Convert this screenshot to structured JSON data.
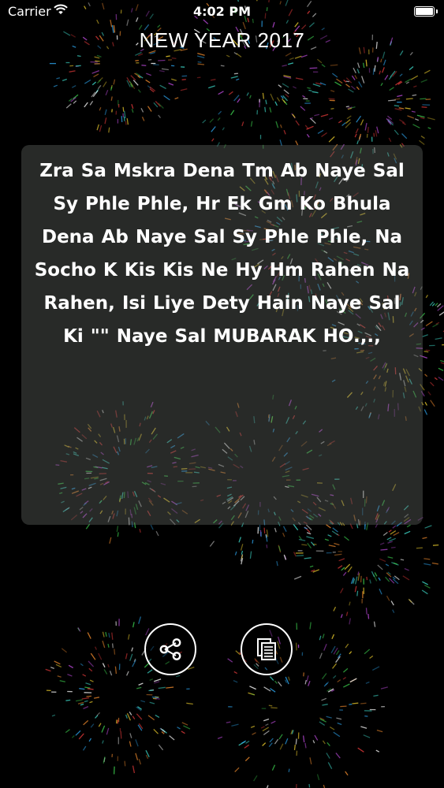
{
  "status_bar": {
    "carrier": "Carrier",
    "time": "4:02 PM",
    "wifi_icon": "wifi-icon",
    "battery_icon": "battery-icon"
  },
  "header": {
    "title": "NEW YEAR 2017"
  },
  "message": {
    "text": "Zra Sa Mskra Dena Tm Ab Naye Sal\nSy Phle Phle,  Hr Ek Gm Ko Bhula\nDena  Ab Naye Sal Sy Phle Phle,  Na\nSocho K Kis Kis Ne  Hy Hm Rahen Na\nRahen,  Isi Liye Dety Hain Naye Sal\nKi      \"\"     Naye Sal  MUBARAK HO.,.,"
  },
  "actions": {
    "share_icon": "share-icon",
    "copy_icon": "copy-icon"
  },
  "colors": {
    "background": "#000000",
    "card": "#5f645f",
    "text": "#ffffff"
  }
}
